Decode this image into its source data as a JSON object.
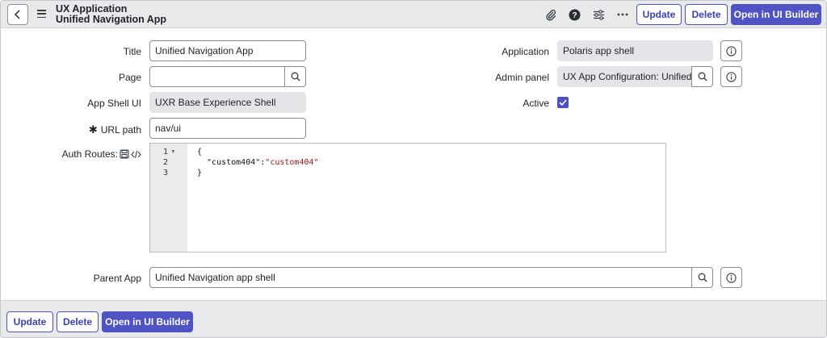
{
  "header": {
    "title_line1": "UX Application",
    "title_line2": "Unified Navigation App",
    "update_label": "Update",
    "delete_label": "Delete",
    "open_builder_label": "Open in UI Builder",
    "icons": [
      "chevron-left-icon",
      "hamburger-menu-icon",
      "paperclip-icon",
      "help-icon",
      "sliders-icon",
      "more-icon"
    ]
  },
  "form": {
    "title": {
      "label": "Title",
      "value": "Unified Navigation App"
    },
    "page": {
      "label": "Page",
      "value": ""
    },
    "app_shell_ui": {
      "label": "App Shell UI",
      "value": "UXR Base Experience Shell"
    },
    "url_path": {
      "label": "URL path",
      "required_mark": "✱",
      "value": "nav/ui"
    },
    "auth_routes": {
      "label": "Auth Routes:"
    },
    "application": {
      "label": "Application",
      "value": "Polaris app shell"
    },
    "admin_panel": {
      "label": "Admin panel",
      "value": "UX App Configuration: Unified"
    },
    "active": {
      "label": "Active",
      "checked": true
    },
    "parent_app": {
      "label": "Parent App",
      "value": "Unified Navigation app shell"
    }
  },
  "code_editor": {
    "line_numbers": [
      "1",
      "2",
      "3"
    ],
    "lines": [
      "{",
      "  \"custom404\":",
      "}"
    ],
    "string_value": "\"custom404\""
  },
  "footer": {
    "update_label": "Update",
    "delete_label": "Delete",
    "open_builder_label": "Open in UI Builder"
  },
  "colors": {
    "accent": "#5053c4",
    "header_bg": "#e8e9eb",
    "readonly_bg": "#e4e5e8",
    "json_string": "#a31515"
  }
}
